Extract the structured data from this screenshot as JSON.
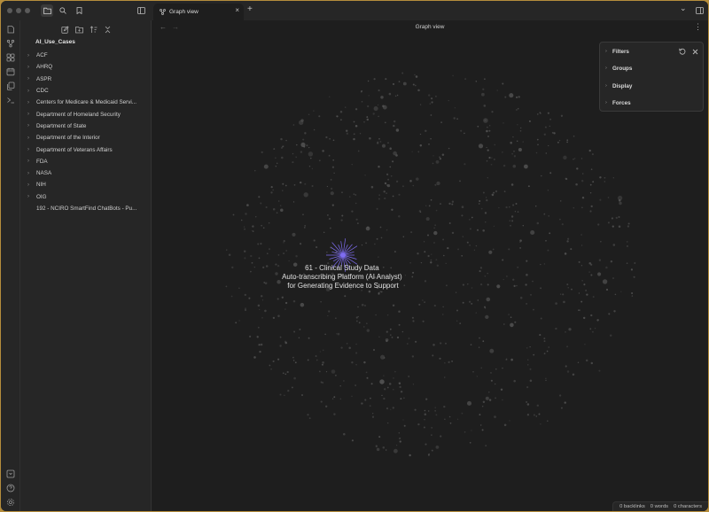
{
  "titlebar": {
    "tab_label": "Graph view",
    "tab_close": "×",
    "new_tab": "+",
    "dropdown": "⌄"
  },
  "sidebar": {
    "vault_name": "AI_Use_Cases",
    "items": [
      {
        "label": "ACF",
        "folder": true
      },
      {
        "label": "AHRQ",
        "folder": true
      },
      {
        "label": "ASPR",
        "folder": true
      },
      {
        "label": "CDC",
        "folder": true
      },
      {
        "label": "Centers for Medicare & Medicaid Servi...",
        "folder": true
      },
      {
        "label": "Department of Homeland Security",
        "folder": true
      },
      {
        "label": "Department of State",
        "folder": true
      },
      {
        "label": "Department of the Interior",
        "folder": true
      },
      {
        "label": "Department of Veterans Affairs",
        "folder": true
      },
      {
        "label": "FDA",
        "folder": true
      },
      {
        "label": "NASA",
        "folder": true
      },
      {
        "label": "NIH",
        "folder": true
      },
      {
        "label": "OIG",
        "folder": true
      },
      {
        "label": "192 - NCIRO SmartFind ChatBots - Pu...",
        "folder": false
      }
    ]
  },
  "main": {
    "view_title": "Graph view",
    "back": "←",
    "forward": "→",
    "more": "⋮",
    "node_label_lines": [
      "61 - Clinical Study Data",
      "Auto-transcribing Platform (AI Analyst)",
      "for Generating Evidence to Support"
    ]
  },
  "graph_controls": {
    "sections": [
      "Filters",
      "Groups",
      "Display",
      "Forces"
    ]
  },
  "statusbar": {
    "backlinks": "0 backlinks",
    "words": "0 words",
    "characters": "0 characters"
  },
  "colors": {
    "accent": "#7f6df2",
    "node": "#5a5a5a",
    "background": "#1e1e1e",
    "panel": "#262626"
  }
}
